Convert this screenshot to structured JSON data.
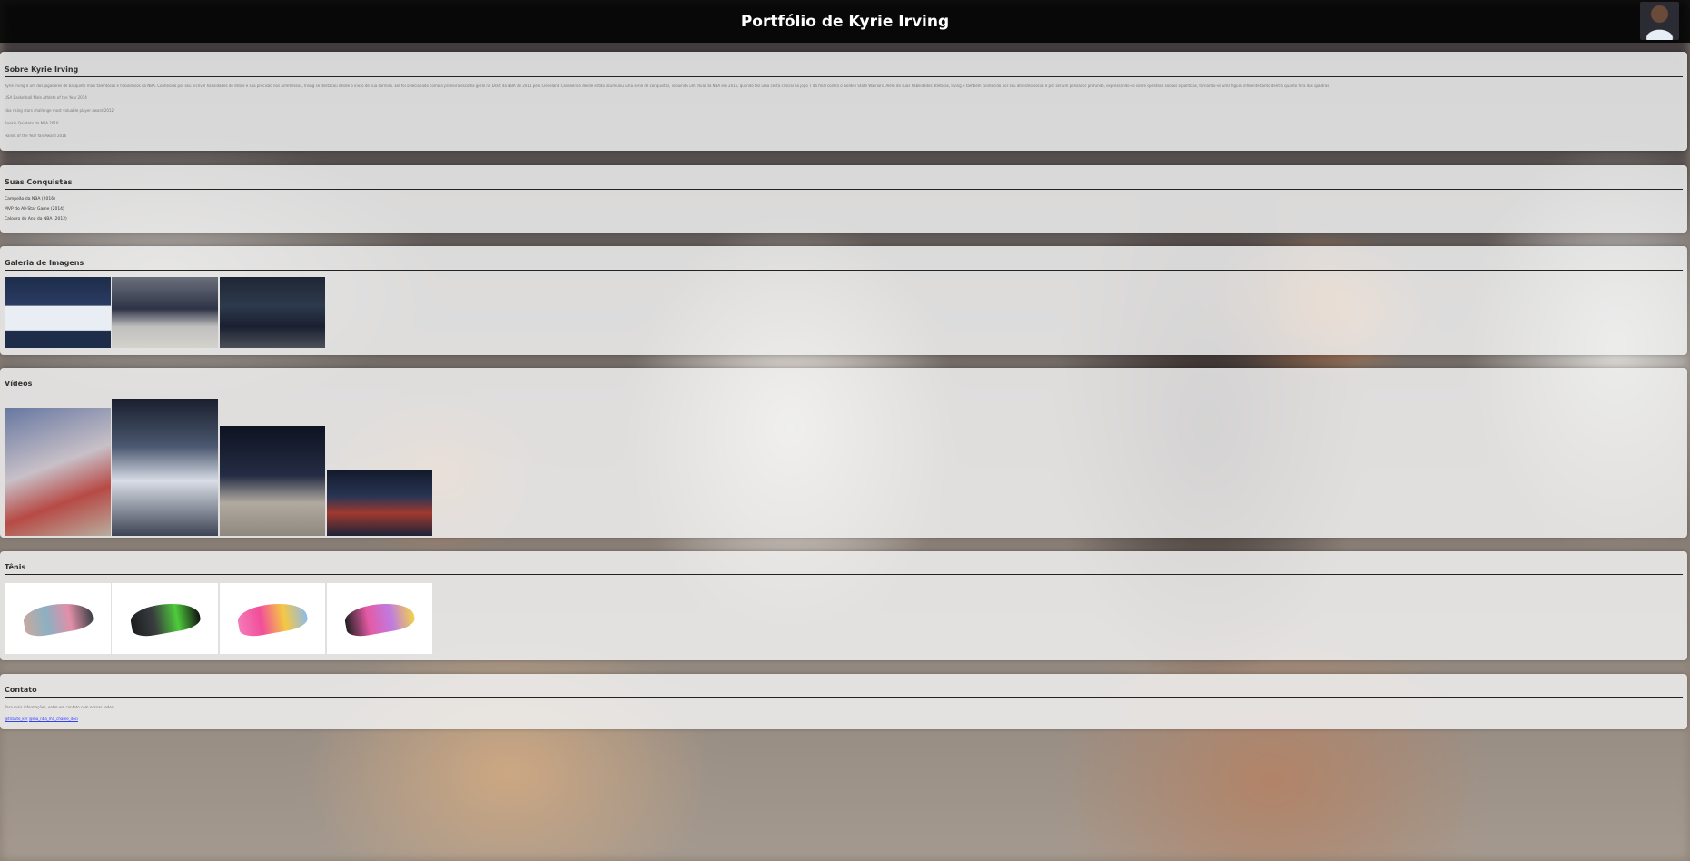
{
  "header": {
    "title": "Portfólio de Kyrie Irving"
  },
  "about": {
    "heading": "Sobre Kyrie Irving",
    "paragraph": "Kyrie Irving é um dos jogadores de basquete mais talentosos e habilidosos da NBA. Conhecido por seu incrível habilidades de drible e sua precisão nos arremessos, Irving se destacou desde o início de sua carreira. Ele foi selecionado como a primeira escolha geral no Draft da NBA de 2011 pelo Cleveland Cavaliers e desde então acumulou uma série de conquistas, incluindo um título da NBA em 2016, quando fez uma cesta crucial no jogo 7 da final contra o Golden State Warriors. Além de suas habilidades atléticas, Irving é também conhecido por seu ativismo social e por ser um pensador profundo, expressando-se sobre questões sociais e políticas, tornando-se uma figura influente tanto dentro quanto fora das quadras.",
    "items": [
      "USA Basketball Male Athlete of the Year 2014",
      "nba rising stars challenge most valuable player award 2012",
      "Rookie Quinteto da NBA 2016",
      "Hands of the Year fan Award 2016"
    ]
  },
  "achievements": {
    "heading": "Suas Conquistas",
    "items": [
      "Campeão da NBA (2016)",
      "MVP do All-Star Game (2014)",
      "Calouro do Ano da NBA (2012)"
    ]
  },
  "gallery": {
    "heading": "Galeria de Imagens"
  },
  "videos": {
    "heading": "Vídeos"
  },
  "shoes": {
    "heading": "Tênis"
  },
  "contact": {
    "heading": "Contato",
    "text": "Para mais informações, entre em contato com nossas redes:",
    "link1": "@tribute_kyr",
    "link2": "@ma_nba_ma_chame_doci"
  }
}
